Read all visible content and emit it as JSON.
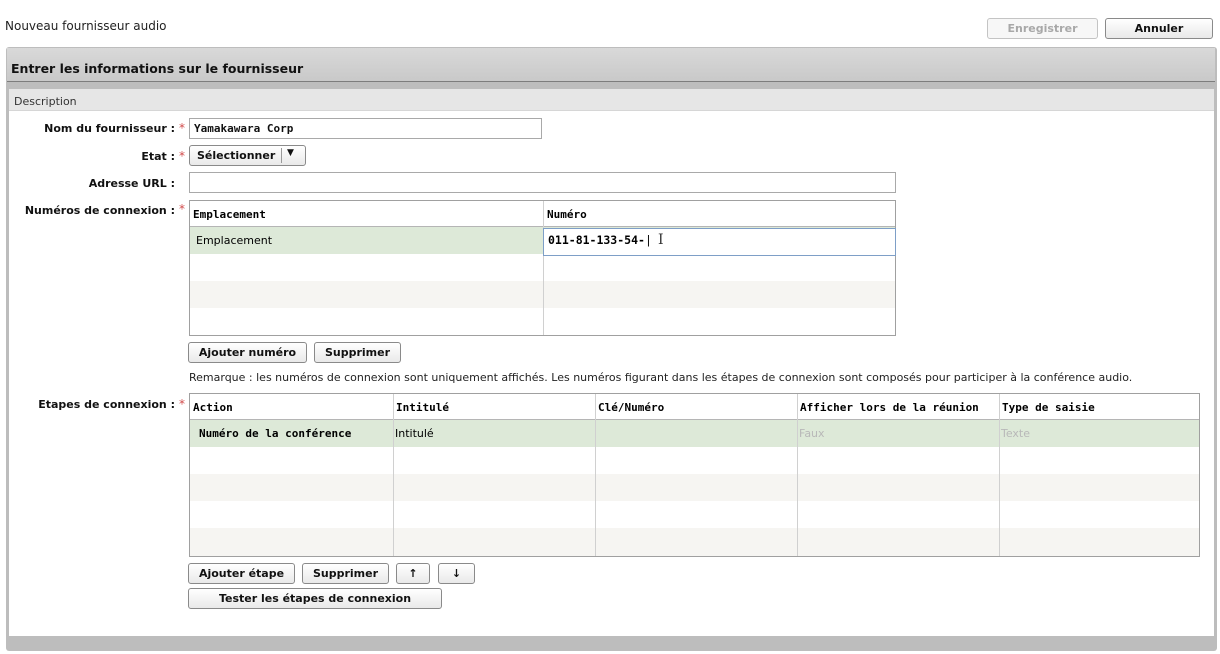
{
  "window": {
    "title": "Nouveau fournisseur audio",
    "save_label": "Enregistrer",
    "cancel_label": "Annuler"
  },
  "panel": {
    "title": "Entrer les informations sur le fournisseur",
    "section": "Description"
  },
  "form": {
    "name_label": "Nom du fournisseur :",
    "name_value": "Yamakawara Corp",
    "state_label": "Etat :",
    "state_selected": "Sélectionner",
    "url_label": "Adresse URL :",
    "url_value": "",
    "numbers_label": "Numéros de connexion :",
    "steps_label": "Etapes de connexion :",
    "required_mark": "*"
  },
  "numbers_table": {
    "columns": [
      "Emplacement",
      "Numéro"
    ],
    "rows": [
      {
        "location": "Emplacement",
        "number": "011-81-133-54-"
      }
    ]
  },
  "numbers_buttons": {
    "add": "Ajouter numéro",
    "delete": "Supprimer"
  },
  "remark": "Remarque : les numéros de connexion sont uniquement affichés. Les numéros figurant dans les étapes de connexion sont composés pour participer à la conférence audio.",
  "steps_table": {
    "columns": [
      "Action",
      "Intitulé",
      "Clé/Numéro",
      "Afficher lors de la réunion",
      "Type de saisie"
    ],
    "rows": [
      {
        "action": "Numéro de la conférence",
        "title": "Intitulé",
        "key": "",
        "show": "Faux",
        "type": "Texte"
      }
    ]
  },
  "steps_buttons": {
    "add": "Ajouter étape",
    "delete": "Supprimer",
    "up": "↑",
    "down": "↓",
    "test": "Tester les étapes de connexion"
  },
  "icons": {
    "dropdown": "chevron-down-icon",
    "cursor": "text-cursor-icon"
  },
  "colors": {
    "selected_row": "#dde9d8",
    "required": "#d14b4b",
    "panel_header": "#cfcfcf"
  }
}
